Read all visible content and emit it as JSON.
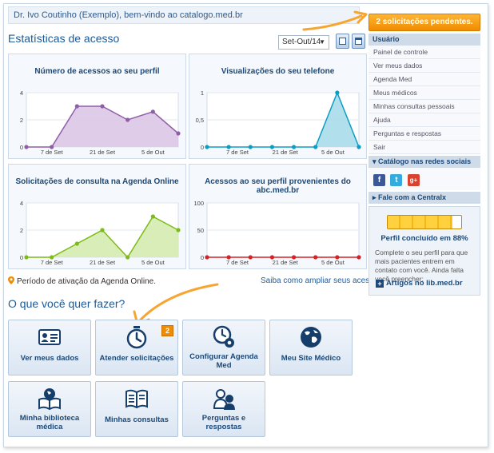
{
  "header": {
    "welcome_text": "Dr. Ivo Coutinho (Exemplo), bem-vindo ao catalogo.med.br",
    "pending_button": "2 solicitações pendentes."
  },
  "stats": {
    "title": "Estatísticas de acesso",
    "period_selected": "Set-Out/14",
    "period_legend": "Período de ativação da Agenda Online.",
    "learn_more": "Saiba como ampliar seus acessos."
  },
  "chart_data": [
    {
      "type": "area",
      "title": "Número de acessos ao seu perfil",
      "x": [
        1,
        2,
        3,
        4,
        5,
        6,
        7
      ],
      "values": [
        0,
        0,
        3,
        3,
        2,
        2.6,
        1
      ],
      "yticks": [
        "4",
        "2",
        "0"
      ],
      "ytick_values": [
        4,
        2,
        0
      ],
      "xticks": [
        "7 de Set",
        "21 de Set",
        "5 de Out"
      ],
      "xtick_positions": [
        2,
        4,
        6
      ],
      "ylim": [
        0,
        4
      ],
      "color": "#8f5ea6",
      "fill": "#dcc6e6"
    },
    {
      "type": "area",
      "title": "Visualizações do seu telefone",
      "x": [
        1,
        2,
        3,
        4,
        5,
        6,
        7,
        8
      ],
      "values": [
        0,
        0,
        0,
        0,
        0,
        0,
        1,
        0
      ],
      "yticks": [
        "1",
        "0,5",
        "0"
      ],
      "ytick_values": [
        1,
        0.5,
        0
      ],
      "xticks": [
        "7 de Set",
        "21 de Set",
        "5 de Out"
      ],
      "xtick_positions": [
        2.4,
        4.6,
        6.8
      ],
      "ylim": [
        0,
        1
      ],
      "color": "#0d9dc4",
      "fill": "#a9dbea"
    },
    {
      "type": "area",
      "title": "Solicitações de consulta na Agenda Online",
      "x": [
        1,
        2,
        3,
        4,
        5,
        6,
        7
      ],
      "values": [
        0,
        0,
        1,
        2,
        0,
        3,
        2
      ],
      "yticks": [
        "4",
        "2",
        "0"
      ],
      "ytick_values": [
        4,
        2,
        0
      ],
      "xticks": [
        "7 de Set",
        "21 de Set",
        "5 de Out"
      ],
      "xtick_positions": [
        2,
        4,
        6
      ],
      "ylim": [
        0,
        4
      ],
      "color": "#7dbb16",
      "fill": "#d4ebb0"
    },
    {
      "type": "line",
      "title": "Acessos ao seu perfil provenientes do abc.med.br",
      "x": [
        1,
        2,
        3,
        4,
        5,
        6,
        7,
        8
      ],
      "values": [
        0,
        0,
        0,
        0,
        0,
        0,
        0,
        0
      ],
      "yticks": [
        "100",
        "50",
        "0"
      ],
      "ytick_values": [
        100,
        50,
        0
      ],
      "xticks": [
        "7 de Set",
        "21 de Set",
        "5 de Out"
      ],
      "xtick_positions": [
        2.4,
        4.6,
        6.8
      ],
      "ylim": [
        0,
        100
      ],
      "color": "#d2232a",
      "fill": "none"
    }
  ],
  "sidebar": {
    "header": "Usuário",
    "items": [
      "Painel de controle",
      "Ver meus dados",
      "Agenda Med",
      "Meus médicos",
      "Minhas consultas pessoais",
      "Ajuda",
      "Perguntas e respostas",
      "Sair"
    ],
    "social_section": "Catálogo nas redes sociais",
    "social_icons": [
      "f",
      "t",
      "g+"
    ],
    "contact_section": "Fale com a Centralx"
  },
  "profile": {
    "completion": 88,
    "completion_label": "Perfil concluído em 88%",
    "text": "Complete o seu perfil para que mais pacientes entrem em contato com você. Ainda falta você preencher:",
    "articles_link": "Artigos no lib.med.br"
  },
  "actions": {
    "title": "O que você quer fazer?",
    "tiles": [
      {
        "label": "Ver meus dados",
        "icon": "id-card-icon"
      },
      {
        "label": "Atender solicitações",
        "icon": "timer-icon",
        "badge": "2"
      },
      {
        "label": "Configurar Agenda Med",
        "icon": "clock-gear-icon"
      },
      {
        "label": "Meu Site Médico",
        "icon": "globe-icon"
      },
      {
        "label": "Minha biblioteca médica",
        "icon": "book-globe-icon"
      },
      {
        "label": "Minhas consultas",
        "icon": "book-list-icon"
      },
      {
        "label": "Perguntas e respostas",
        "icon": "people-chat-icon"
      }
    ]
  },
  "colors": {
    "accent_orange": "#f08c00",
    "title_blue": "#1b5a98",
    "panel_bg": "#f5f8fc"
  }
}
